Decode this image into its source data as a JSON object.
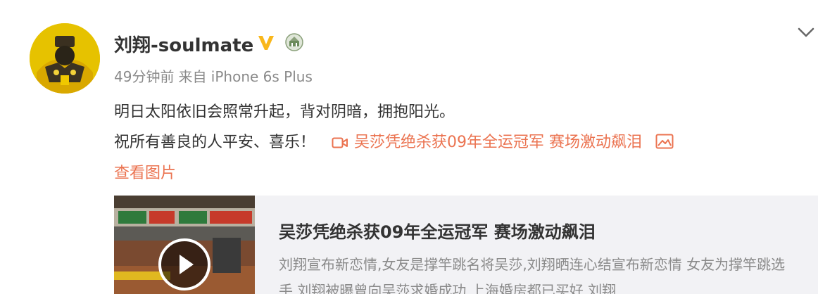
{
  "post": {
    "username": "刘翔-soulmate",
    "verified_icon": "verified-v-icon",
    "badge_icon": "medal-icon",
    "time": "49分钟前",
    "source": "来自 iPhone 6s Plus",
    "text_line1": "明日太阳依旧会照常升起，背对阴暗，拥抱阳光。",
    "text_line2": "祝所有善良的人平安、喜乐！",
    "video_link": "吴莎凭绝杀获09年全运冠军 赛场激动飙泪",
    "view_images": "查看图片",
    "menu_icon": "chevron-down-icon"
  },
  "card": {
    "title": "吴莎凭绝杀获09年全运冠军 赛场激动飙泪",
    "description": "刘翔宣布新恋情,女友是撑竿跳名将吴莎,刘翔晒连心结宣布新恋情 女友为撑竿跳选手 刘翔被曝曾向吴莎求婚成功 上海婚房都已买好 刘翔",
    "play_icon": "play-icon"
  },
  "colors": {
    "link": "#eb7350",
    "verified": "#f9b71b",
    "text": "#333333",
    "meta": "#8a8a8a",
    "card_bg": "#f2f2f5"
  }
}
